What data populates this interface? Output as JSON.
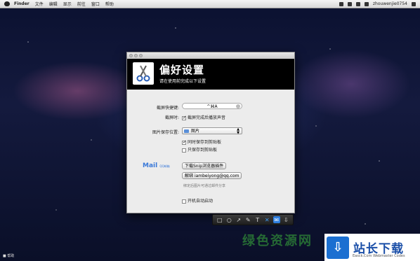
{
  "menubar": {
    "app": "Finder",
    "items": [
      "文件",
      "编辑",
      "显示",
      "前往",
      "窗口",
      "帮助"
    ],
    "user": "zhouwenjie0754"
  },
  "window": {
    "header_title": "偏好设置",
    "header_subtitle": "请在使用前完成以下设置",
    "shortcut_label": "截屏快捷键:",
    "shortcut_value": "^⌘A",
    "on_capture_label": "截屏时:",
    "play_sound_label": "截屏完成后播放声音",
    "save_location_label": "图片保存位置:",
    "save_location_value": "图片",
    "clipboard_also_label": "同时保存到剪贴板",
    "clipboard_only_label": "只保存到剪贴板",
    "mail_logo_text": "Mail",
    "mail_logo_sub": "QQ邮箱",
    "download_plugin_button": "下载Snip浏览器插件",
    "unbind_button": "解绑",
    "email": "iambeiyong@qq.com",
    "note": "绑定后图片可通过邮件分享",
    "launch_at_login_label": "开机自动启动"
  },
  "checkboxes": {
    "play_sound": true,
    "clipboard_also": true,
    "clipboard_only": false,
    "launch_at_login": false
  },
  "toolbar": {
    "tools": [
      "rectangle-icon",
      "ellipse-icon",
      "arrow-icon",
      "brush-icon",
      "text-icon",
      "close-icon",
      "mail-icon",
      "save-icon"
    ]
  },
  "watermark": {
    "green_text": "绿色资源网",
    "site_name": "站长下载",
    "site_url": "Easck.Com Webmaster Codes"
  },
  "dock_hint": "■ 帮助",
  "colors": {
    "accent": "#2f7fe0",
    "header_bg": "#000000",
    "window_bg": "#ececec"
  }
}
